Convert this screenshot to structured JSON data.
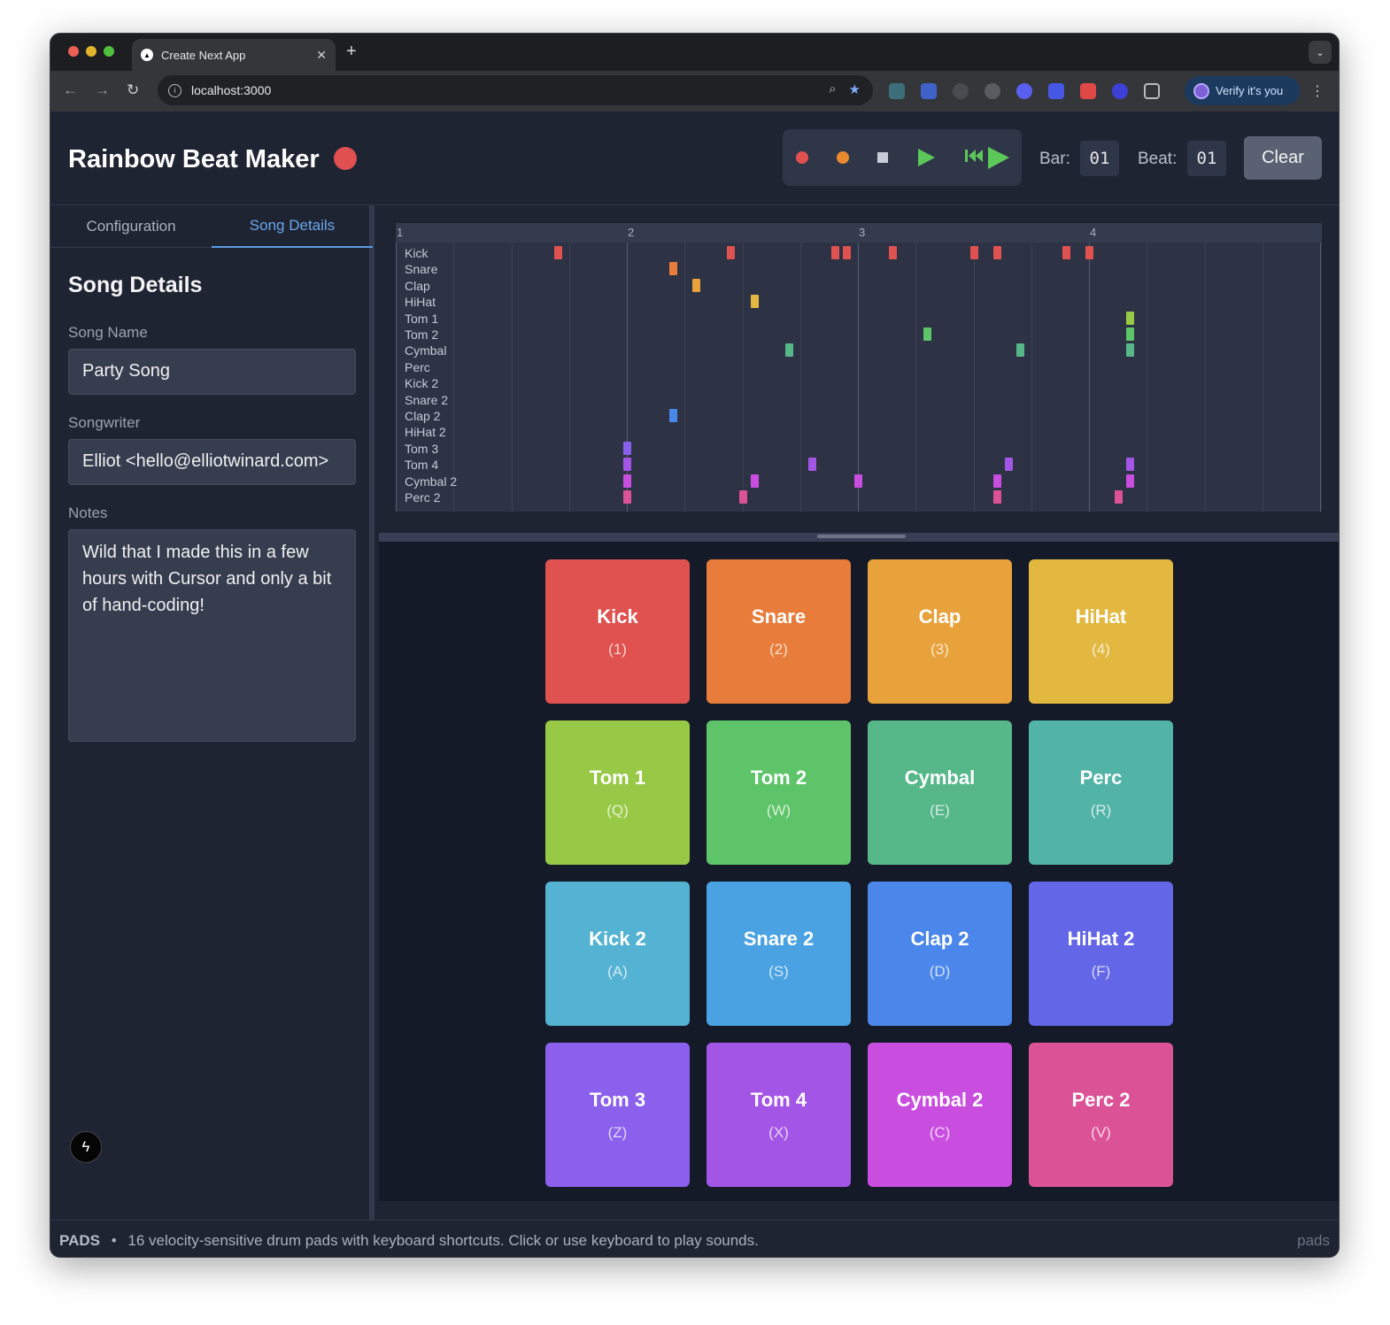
{
  "browser": {
    "tab_title": "Create Next App",
    "tab_close": "✕",
    "new_tab": "+",
    "url": "localhost:3000",
    "verify_label": "Verify it's you"
  },
  "app": {
    "title": "Rainbow Beat Maker",
    "bar_label": "Bar:",
    "bar_value": "01",
    "beat_label": "Beat:",
    "beat_value": "01",
    "clear_label": "Clear"
  },
  "sidebar": {
    "tabs": [
      "Configuration",
      "Song Details"
    ],
    "active_tab": "Song Details",
    "section_title": "Song Details",
    "song_name_label": "Song Name",
    "song_name_value": "Party Song",
    "songwriter_label": "Songwriter",
    "songwriter_value": "Elliot <hello@elliotwinard.com>",
    "notes_label": "Notes",
    "notes_value": "Wild that I made this in a few hours with Cursor and only a bit of hand-coding!"
  },
  "timeline": {
    "bar_numbers": [
      "1",
      "2",
      "3",
      "4"
    ],
    "rows": [
      "Kick",
      "Snare",
      "Clap",
      "HiHat",
      "Tom 1",
      "Tom 2",
      "Cymbal",
      "Perc",
      "Kick 2",
      "Snare 2",
      "Clap 2",
      "HiHat 2",
      "Tom 3",
      "Tom 4",
      "Cymbal 2",
      "Perc 2"
    ],
    "notes_note": "beat positions in 16ths of a bar (bar 1 starts at 0)",
    "notes": [
      {
        "row": 0,
        "pos": [
          2.8,
          5.8,
          7.6,
          7.8,
          8.6,
          10.0,
          10.4,
          11.6,
          12.0
        ]
      },
      {
        "row": 1,
        "pos": [
          4.8
        ]
      },
      {
        "row": 2,
        "pos": [
          5.2
        ]
      },
      {
        "row": 3,
        "pos": [
          6.2
        ]
      },
      {
        "row": 4,
        "pos": [
          12.7
        ]
      },
      {
        "row": 5,
        "pos": [
          9.2,
          12.7
        ]
      },
      {
        "row": 6,
        "pos": [
          6.8,
          10.8,
          12.7
        ]
      },
      {
        "row": 10,
        "pos": [
          4.8
        ]
      },
      {
        "row": 12,
        "pos": [
          4.0
        ]
      },
      {
        "row": 13,
        "pos": [
          4.0,
          7.2,
          10.6,
          12.7
        ]
      },
      {
        "row": 14,
        "pos": [
          4.0,
          6.2,
          8.0,
          10.4,
          12.7
        ]
      },
      {
        "row": 15,
        "pos": [
          4.0,
          6.0,
          10.4,
          12.5
        ]
      }
    ]
  },
  "pads": [
    {
      "name": "Kick",
      "key": "(1)",
      "color": "#df524f"
    },
    {
      "name": "Snare",
      "key": "(2)",
      "color": "#e77c3b"
    },
    {
      "name": "Clap",
      "key": "(3)",
      "color": "#e8a23b"
    },
    {
      "name": "HiHat",
      "key": "(4)",
      "color": "#e2b840"
    },
    {
      "name": "Tom 1",
      "key": "(Q)",
      "color": "#98c946"
    },
    {
      "name": "Tom 2",
      "key": "(W)",
      "color": "#5ec46a"
    },
    {
      "name": "Cymbal",
      "key": "(E)",
      "color": "#56b789"
    },
    {
      "name": "Perc",
      "key": "(R)",
      "color": "#52b4a6"
    },
    {
      "name": "Kick 2",
      "key": "(A)",
      "color": "#54b2d3"
    },
    {
      "name": "Snare 2",
      "key": "(S)",
      "color": "#4aa2e2"
    },
    {
      "name": "Clap 2",
      "key": "(D)",
      "color": "#4b86ea"
    },
    {
      "name": "HiHat 2",
      "key": "(F)",
      "color": "#6366e6"
    },
    {
      "name": "Tom 3",
      "key": "(Z)",
      "color": "#8a60ec"
    },
    {
      "name": "Tom 4",
      "key": "(X)",
      "color": "#a356e6"
    },
    {
      "name": "Cymbal 2",
      "key": "(C)",
      "color": "#c94ee0"
    },
    {
      "name": "Perc 2",
      "key": "(V)",
      "color": "#db5396"
    }
  ],
  "footer": {
    "mode": "PADS",
    "separator": "•",
    "description": "16 velocity-sensitive drum pads with keyboard shortcuts. Click or use keyboard to play sounds.",
    "right_label": "pads"
  },
  "icons": {
    "record": "record-icon",
    "overdub": "overdub-icon",
    "stop": "stop-icon",
    "play": "play-icon",
    "play-from-start": "rewind-play-icon"
  }
}
